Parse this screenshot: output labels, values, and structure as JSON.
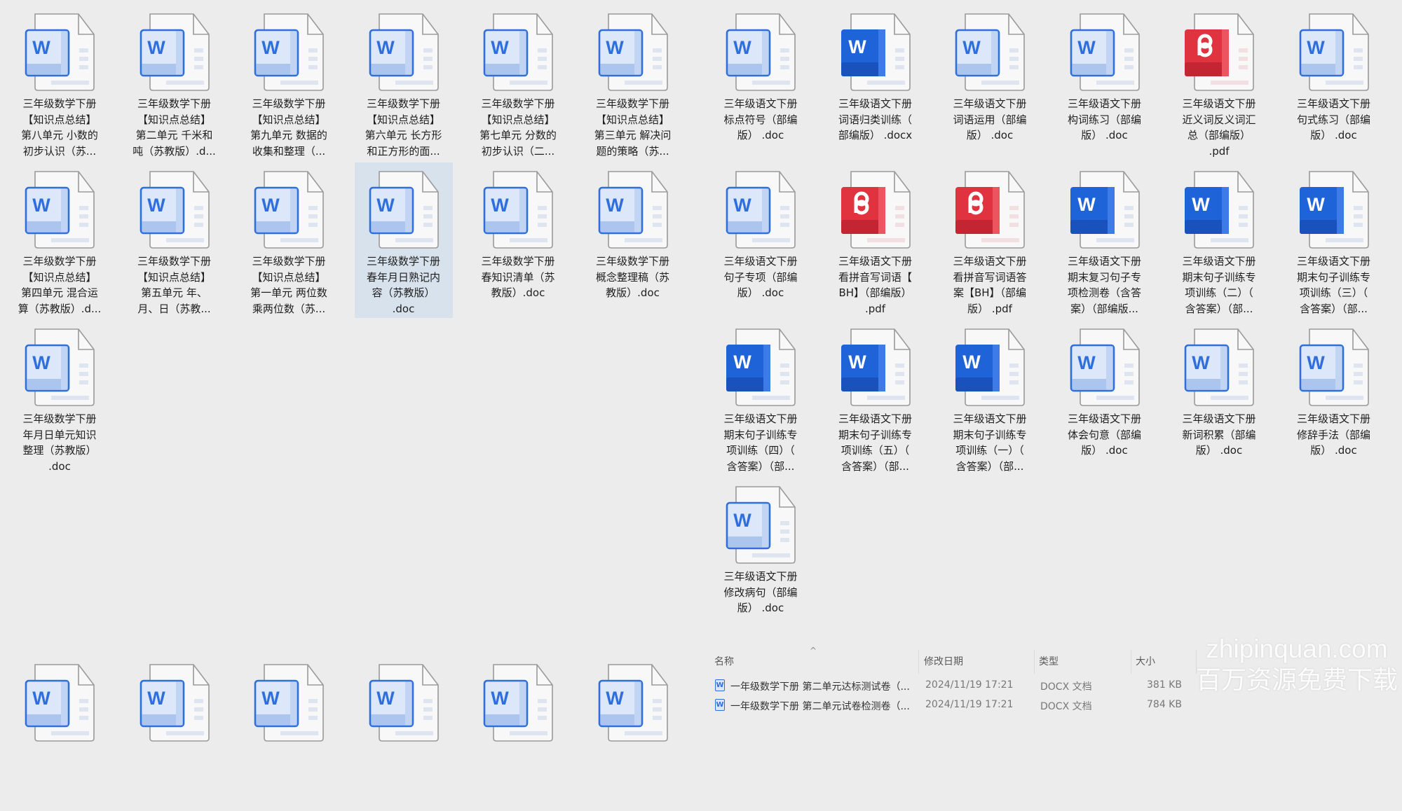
{
  "colors": {
    "word_blue": "#2f6fdc",
    "word_solid": "#1f63d8",
    "pdf_red": "#e0323f",
    "selection": "#d7e2ec",
    "background": "#ececec"
  },
  "left_files": [
    {
      "icon": "word-outline",
      "lines": [
        "三年级数学下册",
        "【知识点总结】",
        "第八单元 小数的",
        "初步认识（苏..."
      ]
    },
    {
      "icon": "word-outline",
      "lines": [
        "三年级数学下册",
        "【知识点总结】",
        "第二单元 千米和",
        "吨（苏教版）.d..."
      ]
    },
    {
      "icon": "word-outline",
      "lines": [
        "三年级数学下册",
        "【知识点总结】",
        "第九单元 数据的",
        "收集和整理（..."
      ]
    },
    {
      "icon": "word-outline",
      "lines": [
        "三年级数学下册",
        "【知识点总结】",
        "第六单元 长方形",
        "和正方形的面..."
      ]
    },
    {
      "icon": "word-outline",
      "lines": [
        "三年级数学下册",
        "【知识点总结】",
        "第七单元 分数的",
        "初步认识（二..."
      ]
    },
    {
      "icon": "word-outline",
      "lines": [
        "三年级数学下册",
        "【知识点总结】",
        "第三单元 解决问",
        "题的策略（苏..."
      ]
    },
    {
      "icon": "word-outline",
      "lines": [
        "三年级数学下册",
        "【知识点总结】",
        "第四单元 混合运",
        "算（苏教版）.d..."
      ]
    },
    {
      "icon": "word-outline",
      "lines": [
        "三年级数学下册",
        "【知识点总结】",
        "第五单元 年、",
        "月、日（苏教..."
      ]
    },
    {
      "icon": "word-outline",
      "lines": [
        "三年级数学下册",
        "【知识点总结】",
        "第一单元 两位数",
        "乘两位数（苏..."
      ]
    },
    {
      "icon": "word-outline",
      "selected": true,
      "lines": [
        "三年级数学下册",
        "春年月日熟记内",
        "容（苏教版）",
        ".doc"
      ]
    },
    {
      "icon": "word-outline",
      "lines": [
        "三年级数学下册",
        "春知识清单（苏",
        "教版）.doc"
      ]
    },
    {
      "icon": "word-outline",
      "lines": [
        "三年级数学下册",
        "概念整理稿（苏",
        "教版）.doc"
      ]
    },
    {
      "icon": "word-outline",
      "lines": [
        "三年级数学下册",
        "年月日单元知识",
        "整理（苏教版）",
        ".doc"
      ]
    }
  ],
  "left_partial_icons": [
    "word-outline",
    "word-outline",
    "word-outline",
    "word-outline",
    "word-outline",
    "word-outline"
  ],
  "right_files": [
    {
      "icon": "word-outline",
      "lines": [
        "三年级语文下册",
        "标点符号（部编",
        "版） .doc"
      ]
    },
    {
      "icon": "word-solid",
      "lines": [
        "三年级语文下册",
        "词语归类训练（",
        "部编版） .docx"
      ]
    },
    {
      "icon": "word-outline",
      "lines": [
        "三年级语文下册",
        "词语运用（部编",
        "版） .doc"
      ]
    },
    {
      "icon": "word-outline",
      "lines": [
        "三年级语文下册",
        "构词练习（部编",
        "版） .doc"
      ]
    },
    {
      "icon": "pdf",
      "lines": [
        "三年级语文下册",
        "近义词反义词汇",
        "总（部编版）",
        ".pdf"
      ]
    },
    {
      "icon": "word-outline",
      "lines": [
        "三年级语文下册",
        "句式练习（部编",
        "版） .doc"
      ]
    },
    {
      "icon": "word-outline",
      "lines": [
        "三年级语文下册",
        "句子专项（部编",
        "版） .doc"
      ]
    },
    {
      "icon": "pdf",
      "lines": [
        "三年级语文下册",
        "看拼音写词语【",
        "BH】（部编版）",
        ".pdf"
      ]
    },
    {
      "icon": "pdf",
      "lines": [
        "三年级语文下册",
        "看拼音写词语答",
        "案【BH】（部编",
        "版） .pdf"
      ]
    },
    {
      "icon": "word-solid",
      "lines": [
        "三年级语文下册",
        "期末复习句子专",
        "项检测卷（含答",
        "案）（部编版..."
      ]
    },
    {
      "icon": "word-solid",
      "lines": [
        "三年级语文下册",
        "期末句子训练专",
        "项训练（二）（",
        "含答案）（部..."
      ]
    },
    {
      "icon": "word-solid",
      "lines": [
        "三年级语文下册",
        "期末句子训练专",
        "项训练（三）（",
        "含答案）（部..."
      ]
    },
    {
      "icon": "word-solid",
      "lines": [
        "三年级语文下册",
        "期末句子训练专",
        "项训练（四）（",
        "含答案）（部..."
      ]
    },
    {
      "icon": "word-solid",
      "lines": [
        "三年级语文下册",
        "期末句子训练专",
        "项训练（五）（",
        "含答案）（部..."
      ]
    },
    {
      "icon": "word-solid",
      "lines": [
        "三年级语文下册",
        "期末句子训练专",
        "项训练（一）（",
        "含答案）（部..."
      ]
    },
    {
      "icon": "word-outline",
      "lines": [
        "三年级语文下册",
        "体会句意（部编",
        "版） .doc"
      ]
    },
    {
      "icon": "word-outline",
      "lines": [
        "三年级语文下册",
        "新词积累（部编",
        "版） .doc"
      ]
    },
    {
      "icon": "word-outline",
      "lines": [
        "三年级语文下册",
        "修辞手法（部编",
        "版） .doc"
      ]
    },
    {
      "icon": "word-outline",
      "lines": [
        "三年级语文下册",
        "修改病句（部编",
        "版） .doc"
      ]
    }
  ],
  "details": {
    "headers": {
      "name": "名称",
      "date": "修改日期",
      "type": "类型",
      "size": "大小"
    },
    "sort_indicator": "^",
    "rows": [
      {
        "name": "一年级数学下册 第二单元达标测试卷（...",
        "date": "2024/11/19 17:21",
        "type": "DOCX 文档",
        "size": "381 KB"
      },
      {
        "name": "一年级数学下册 第二单元试卷检测卷（...",
        "date": "2024/11/19 17:21",
        "type": "DOCX 文档",
        "size": "784 KB"
      }
    ]
  },
  "watermark": {
    "domain": "zhipinquan.com",
    "slogan": "百万资源免费下载"
  }
}
